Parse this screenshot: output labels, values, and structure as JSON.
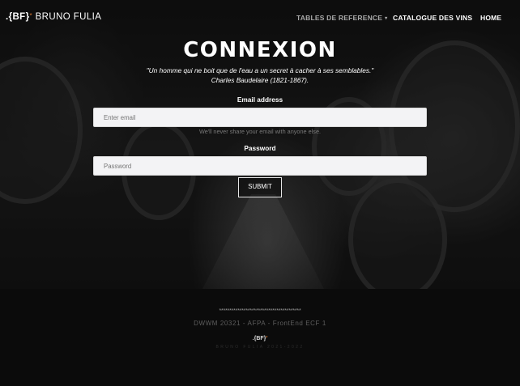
{
  "navbar": {
    "brand_prefix": ".{BF}",
    "brand_star": "*",
    "brand_name": "BRUNO FULIA",
    "links": [
      {
        "label": "TABLES DE REFERENCE",
        "dropdown": true
      },
      {
        "label": "CATALOGUE DES VINS"
      },
      {
        "label": "HOME"
      }
    ]
  },
  "login": {
    "title": "CONNEXION",
    "quote_line1": "\"Un homme qui ne boit que de l'eau a un secret à cacher à ses semblables.\"",
    "quote_line2": "Charles Baudelaire (1821-1867).",
    "email_label": "Email address",
    "email_placeholder": "Enter email",
    "email_help": "We'll never share your email with anyone else.",
    "password_label": "Password",
    "password_placeholder": "Password",
    "submit_label": "SUBMIT"
  },
  "footer": {
    "stars": "****************************************",
    "line": "DWWM 20321 - AFPA - FrontEnd ECF 1",
    "logo": ".{BF}",
    "logo_star": "*",
    "copyright": "BRUNO FULIA 2021-2022"
  }
}
